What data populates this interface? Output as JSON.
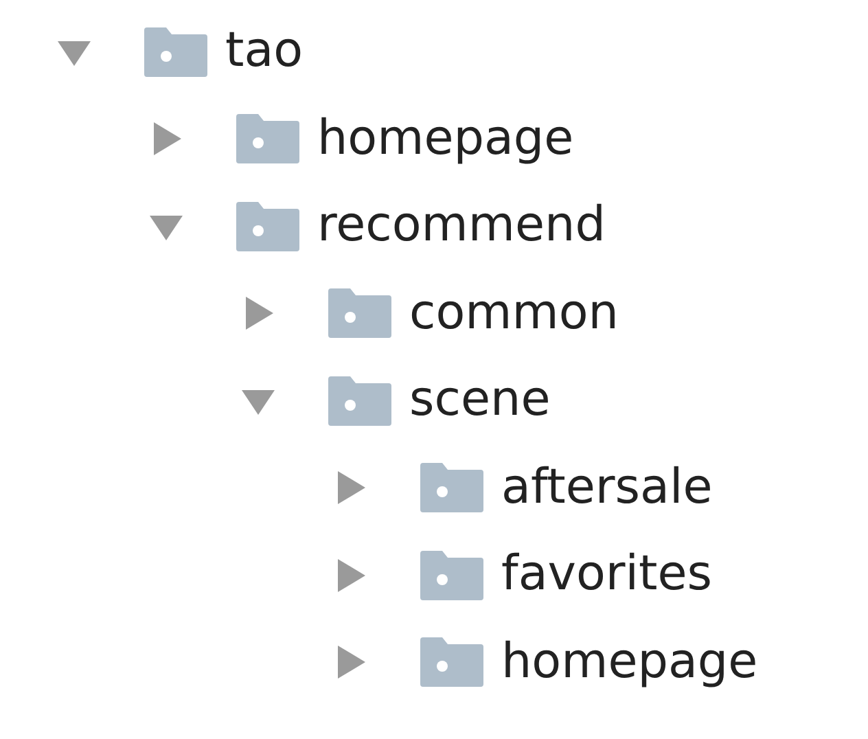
{
  "tree": [
    {
      "label": "tao",
      "expanded": true,
      "children": [
        {
          "label": "homepage",
          "expanded": false
        },
        {
          "label": "recommend",
          "expanded": true,
          "children": [
            {
              "label": "common",
              "expanded": false
            },
            {
              "label": "scene",
              "expanded": true,
              "children": [
                {
                  "label": "aftersale",
                  "expanded": false
                },
                {
                  "label": "favorites",
                  "expanded": false
                },
                {
                  "label": "homepage",
                  "expanded": false
                }
              ]
            }
          ]
        }
      ]
    }
  ]
}
